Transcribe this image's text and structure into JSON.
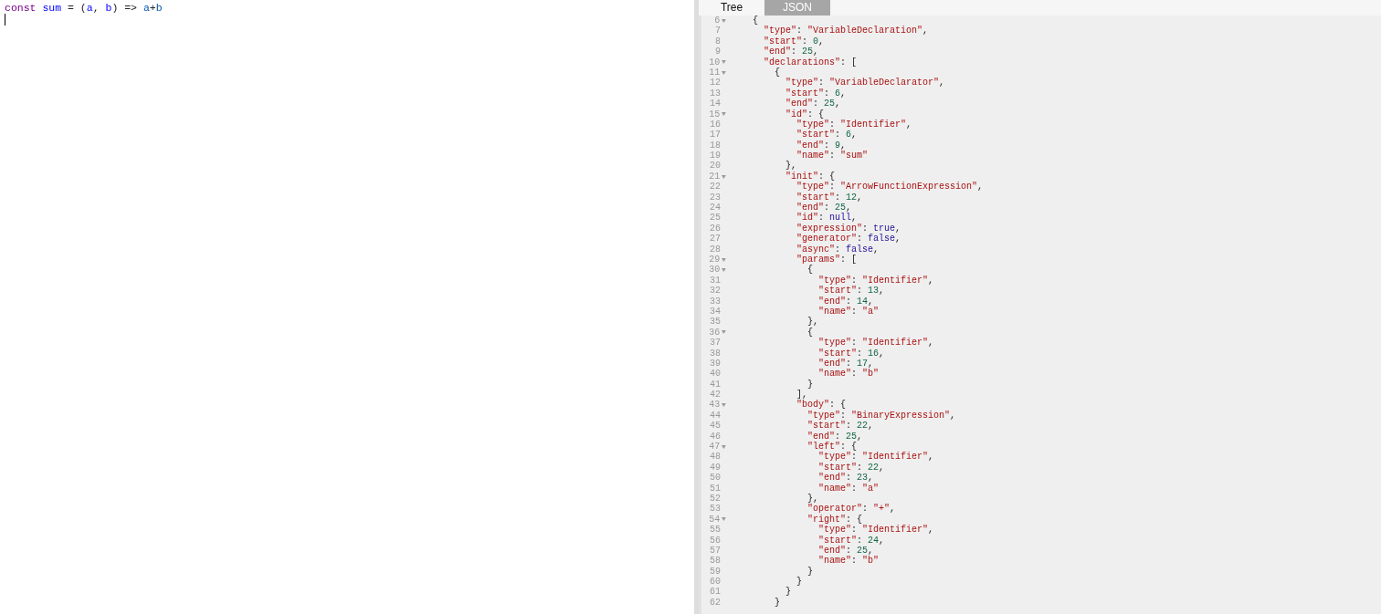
{
  "editor": {
    "lines": [
      {
        "segments": [
          {
            "text": "const ",
            "kind": "keyword"
          },
          {
            "text": "sum",
            "kind": "def"
          },
          {
            "text": " = (",
            "kind": "operator"
          },
          {
            "text": "a",
            "kind": "def"
          },
          {
            "text": ", ",
            "kind": "operator"
          },
          {
            "text": "b",
            "kind": "def"
          },
          {
            "text": ") => ",
            "kind": "operator"
          },
          {
            "text": "a",
            "kind": "variable"
          },
          {
            "text": "+",
            "kind": "operator"
          },
          {
            "text": "b",
            "kind": "variable"
          }
        ]
      },
      {
        "cursor": true
      }
    ]
  },
  "tabs": [
    {
      "label": "Tree",
      "selected": false
    },
    {
      "label": "JSON",
      "selected": true
    }
  ],
  "output": {
    "lines": [
      {
        "number": "6",
        "fold": true,
        "text": "    {"
      },
      {
        "number": "7",
        "fold": false,
        "text": "      \"type\": \"VariableDeclaration\","
      },
      {
        "number": "8",
        "fold": false,
        "text": "      \"start\": 0,"
      },
      {
        "number": "9",
        "fold": false,
        "text": "      \"end\": 25,"
      },
      {
        "number": "10",
        "fold": true,
        "text": "      \"declarations\": ["
      },
      {
        "number": "11",
        "fold": true,
        "text": "        {"
      },
      {
        "number": "12",
        "fold": false,
        "text": "          \"type\": \"VariableDeclarator\","
      },
      {
        "number": "13",
        "fold": false,
        "text": "          \"start\": 6,"
      },
      {
        "number": "14",
        "fold": false,
        "text": "          \"end\": 25,"
      },
      {
        "number": "15",
        "fold": true,
        "text": "          \"id\": {"
      },
      {
        "number": "16",
        "fold": false,
        "text": "            \"type\": \"Identifier\","
      },
      {
        "number": "17",
        "fold": false,
        "text": "            \"start\": 6,"
      },
      {
        "number": "18",
        "fold": false,
        "text": "            \"end\": 9,"
      },
      {
        "number": "19",
        "fold": false,
        "text": "            \"name\": \"sum\""
      },
      {
        "number": "20",
        "fold": false,
        "text": "          },"
      },
      {
        "number": "21",
        "fold": true,
        "text": "          \"init\": {"
      },
      {
        "number": "22",
        "fold": false,
        "text": "            \"type\": \"ArrowFunctionExpression\","
      },
      {
        "number": "23",
        "fold": false,
        "text": "            \"start\": 12,"
      },
      {
        "number": "24",
        "fold": false,
        "text": "            \"end\": 25,"
      },
      {
        "number": "25",
        "fold": false,
        "text": "            \"id\": null,"
      },
      {
        "number": "26",
        "fold": false,
        "text": "            \"expression\": true,"
      },
      {
        "number": "27",
        "fold": false,
        "text": "            \"generator\": false,"
      },
      {
        "number": "28",
        "fold": false,
        "text": "            \"async\": false,"
      },
      {
        "number": "29",
        "fold": true,
        "text": "            \"params\": ["
      },
      {
        "number": "30",
        "fold": true,
        "text": "              {"
      },
      {
        "number": "31",
        "fold": false,
        "text": "                \"type\": \"Identifier\","
      },
      {
        "number": "32",
        "fold": false,
        "text": "                \"start\": 13,"
      },
      {
        "number": "33",
        "fold": false,
        "text": "                \"end\": 14,"
      },
      {
        "number": "34",
        "fold": false,
        "text": "                \"name\": \"a\""
      },
      {
        "number": "35",
        "fold": false,
        "text": "              },"
      },
      {
        "number": "36",
        "fold": true,
        "text": "              {"
      },
      {
        "number": "37",
        "fold": false,
        "text": "                \"type\": \"Identifier\","
      },
      {
        "number": "38",
        "fold": false,
        "text": "                \"start\": 16,"
      },
      {
        "number": "39",
        "fold": false,
        "text": "                \"end\": 17,"
      },
      {
        "number": "40",
        "fold": false,
        "text": "                \"name\": \"b\""
      },
      {
        "number": "41",
        "fold": false,
        "text": "              }"
      },
      {
        "number": "42",
        "fold": false,
        "text": "            ],"
      },
      {
        "number": "43",
        "fold": true,
        "text": "            \"body\": {"
      },
      {
        "number": "44",
        "fold": false,
        "text": "              \"type\": \"BinaryExpression\","
      },
      {
        "number": "45",
        "fold": false,
        "text": "              \"start\": 22,"
      },
      {
        "number": "46",
        "fold": false,
        "text": "              \"end\": 25,"
      },
      {
        "number": "47",
        "fold": true,
        "text": "              \"left\": {"
      },
      {
        "number": "48",
        "fold": false,
        "text": "                \"type\": \"Identifier\","
      },
      {
        "number": "49",
        "fold": false,
        "text": "                \"start\": 22,"
      },
      {
        "number": "50",
        "fold": false,
        "text": "                \"end\": 23,"
      },
      {
        "number": "51",
        "fold": false,
        "text": "                \"name\": \"a\""
      },
      {
        "number": "52",
        "fold": false,
        "text": "              },"
      },
      {
        "number": "53",
        "fold": false,
        "text": "              \"operator\": \"+\","
      },
      {
        "number": "54",
        "fold": true,
        "text": "              \"right\": {"
      },
      {
        "number": "55",
        "fold": false,
        "text": "                \"type\": \"Identifier\","
      },
      {
        "number": "56",
        "fold": false,
        "text": "                \"start\": 24,"
      },
      {
        "number": "57",
        "fold": false,
        "text": "                \"end\": 25,"
      },
      {
        "number": "58",
        "fold": false,
        "text": "                \"name\": \"b\""
      },
      {
        "number": "59",
        "fold": false,
        "text": "              }"
      },
      {
        "number": "60",
        "fold": false,
        "text": "            }"
      },
      {
        "number": "61",
        "fold": false,
        "text": "          }"
      },
      {
        "number": "62",
        "fold": false,
        "text": "        }"
      }
    ]
  }
}
